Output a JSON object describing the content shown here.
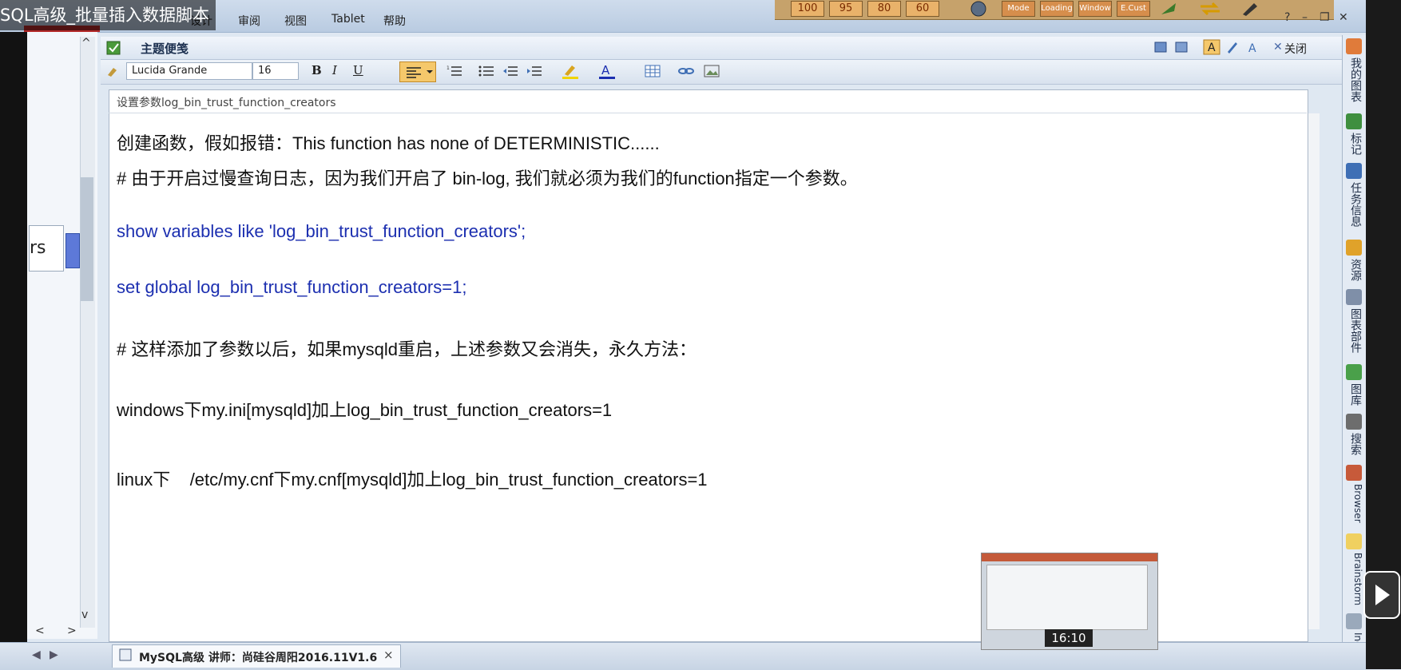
{
  "video": {
    "title": "SQL高级_批量插入数据脚本",
    "thumb_time": "16:10"
  },
  "menu": {
    "items": [
      "设计",
      "审阅",
      "视图",
      "Tablet",
      "帮助"
    ]
  },
  "zoom_bar": {
    "buttons": [
      "100",
      "95",
      "80",
      "60"
    ],
    "modes": [
      "Mode",
      "Loading",
      "Window",
      "E.Cust"
    ]
  },
  "left_pane": {
    "box_text": "rs"
  },
  "note": {
    "title": "主题便笺",
    "close_label": "关闭"
  },
  "format": {
    "font": "Lucida Grande",
    "size": "16",
    "bold": "B",
    "italic": "I",
    "underline": "U"
  },
  "document": {
    "title": "设置参数log_bin_trust_function_creators",
    "lines": [
      "创建函数，假如报错：This function has none of DETERMINISTIC......",
      "# 由于开启过慢查询日志，因为我们开启了 bin-log, 我们就必须为我们的function指定一个参数。",
      "show variables like 'log_bin_trust_function_creators';",
      "set global log_bin_trust_function_creators=1;",
      "# 这样添加了参数以后，如果mysqld重启，上述参数又会消失，永久方法：",
      "windows下my.ini[mysqld]加上log_bin_trust_function_creators=1",
      "linux下    /etc/my.cnf下my.cnf[mysqld]加上log_bin_trust_function_creators=1"
    ]
  },
  "right_tabs": [
    "我的图表",
    "标记",
    "任务信息",
    "资源",
    "图表部件",
    "图库",
    "搜索",
    "Browser",
    "Brainstorm",
    "Index"
  ],
  "bottom_tab": {
    "label": "MySQL高级 讲师：尚硅谷周阳2016.11V1.6",
    "close": "×"
  },
  "colors": {
    "link_blue": "#1c2fb0",
    "align_active": "#f5c86b"
  }
}
